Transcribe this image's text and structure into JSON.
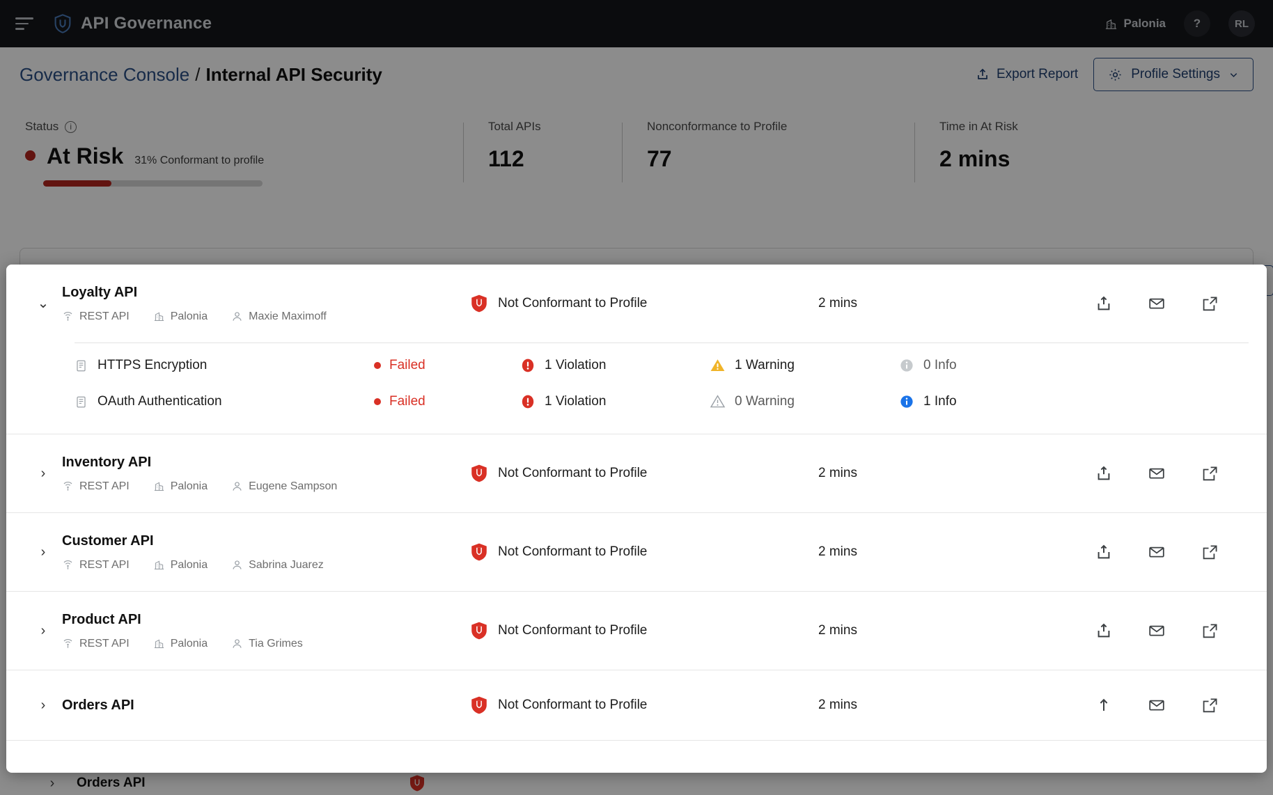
{
  "header": {
    "menu_icon": "hamburger-icon",
    "logo_icon": "shield-logo-icon",
    "title": "API Governance",
    "org_icon": "building-icon",
    "org_name": "Palonia",
    "help_label": "?",
    "avatar_initials": "RL"
  },
  "breadcrumb": {
    "parent": "Governance Console",
    "separator": "/",
    "current": "Internal API Security",
    "export_label": "Export Report",
    "export_icon": "upload-share-icon",
    "profile_settings_label": "Profile Settings",
    "profile_settings_icon": "gear-icon",
    "chevron_icon": "chevron-down-icon"
  },
  "stats": [
    {
      "label": "Status",
      "has_info_icon": true,
      "info_icon": "info-circle-icon",
      "value": "At Risk",
      "sub": "31% Conformant to profile",
      "dot_color": "#b3261e",
      "progress_percent": 31
    },
    {
      "label": "Total APIs",
      "value": "112"
    },
    {
      "label": "Nonconformance to Profile",
      "value": "77"
    },
    {
      "label": "Time in At Risk",
      "value": "2 mins"
    }
  ],
  "colors": {
    "accent": "#2b4f86",
    "danger": "#d93025",
    "danger_dark": "#b3261e",
    "warning": "#f0b429",
    "info": "#1a73e8",
    "muted": "#9aa0a6"
  },
  "api_list": [
    {
      "name": "Loyalty API",
      "expanded": true,
      "chevron": "chevron-down-icon",
      "meta": [
        {
          "icon": "api-node-icon",
          "label": "REST API"
        },
        {
          "icon": "building-icon",
          "label": "Palonia"
        },
        {
          "icon": "user-icon",
          "label": "Maxie Maximoff"
        }
      ],
      "status_icon": "shield-alert-icon",
      "status": "Not Conformant to Profile",
      "time": "2 mins",
      "actions": [
        "share-icon",
        "mail-icon",
        "external-link-icon"
      ],
      "checks": [
        {
          "icon": "policy-doc-icon",
          "name": "HTTPS Encryption",
          "result": "Failed",
          "violations": "1 Violation",
          "violations_state": "danger",
          "warnings": "1 Warning",
          "warnings_state": "warning",
          "info": "0 Info",
          "info_state": "muted",
          "action": "external-link-icon"
        },
        {
          "icon": "policy-doc-icon",
          "name": "OAuth Authentication",
          "result": "Failed",
          "violations": "1 Violation",
          "violations_state": "danger",
          "warnings": "0 Warning",
          "warnings_state": "muted",
          "info": "1 Info",
          "info_state": "info",
          "action": "external-link-icon"
        }
      ]
    },
    {
      "name": "Inventory API",
      "expanded": false,
      "chevron": "chevron-right-icon",
      "meta": [
        {
          "icon": "api-node-icon",
          "label": "REST API"
        },
        {
          "icon": "building-icon",
          "label": "Palonia"
        },
        {
          "icon": "user-icon",
          "label": "Eugene Sampson"
        }
      ],
      "status_icon": "shield-alert-icon",
      "status": "Not Conformant to Profile",
      "time": "2 mins",
      "actions": [
        "share-icon",
        "mail-icon",
        "external-link-icon"
      ],
      "checks": []
    },
    {
      "name": "Customer API",
      "expanded": false,
      "chevron": "chevron-right-icon",
      "meta": [
        {
          "icon": "api-node-icon",
          "label": "REST API"
        },
        {
          "icon": "building-icon",
          "label": "Palonia"
        },
        {
          "icon": "user-icon",
          "label": "Sabrina Juarez"
        }
      ],
      "status_icon": "shield-alert-icon",
      "status": "Not Conformant to Profile",
      "time": "2 mins",
      "actions": [
        "share-icon",
        "mail-icon",
        "external-link-icon"
      ],
      "checks": []
    },
    {
      "name": "Product API",
      "expanded": false,
      "chevron": "chevron-right-icon",
      "meta": [
        {
          "icon": "api-node-icon",
          "label": "REST API"
        },
        {
          "icon": "building-icon",
          "label": "Palonia"
        },
        {
          "icon": "user-icon",
          "label": "Tia Grimes"
        }
      ],
      "status_icon": "shield-alert-icon",
      "status": "Not Conformant to Profile",
      "time": "2 mins",
      "actions": [
        "share-icon",
        "mail-icon",
        "external-link-icon"
      ],
      "checks": []
    },
    {
      "name": "Orders API",
      "expanded": false,
      "chevron": "chevron-right-icon",
      "meta": [],
      "status_icon": "shield-alert-icon",
      "status": "Not Conformant to Profile",
      "time": "2 mins",
      "actions": [
        "arrow-up-icon",
        "mail-icon",
        "external-link-icon"
      ],
      "checks": []
    }
  ],
  "background_row": {
    "name": "Orders API",
    "chevron": "chevron-right-icon",
    "status_icon": "shield-alert-icon"
  }
}
